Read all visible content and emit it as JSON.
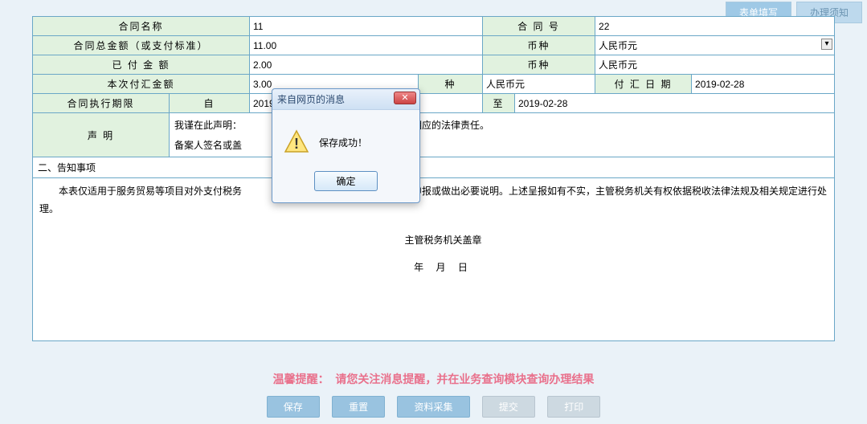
{
  "top_tabs": {
    "fill": "表单填写",
    "notes": "办理须知"
  },
  "form": {
    "row1": {
      "l1": "合同名称",
      "v1": "11",
      "l2": "合 同 号",
      "v2": "22"
    },
    "row2": {
      "l1": "合同总金额（或支付标准）",
      "v1": "11.00",
      "l2": "币种",
      "v2": "人民币元"
    },
    "row3": {
      "l1": "已 付 金 额",
      "v1": "2.00",
      "l2": "币种",
      "v2": "人民币元"
    },
    "row4": {
      "l1": "本次付汇金额",
      "v1": "3.00",
      "l2a": "",
      "l2b": "种",
      "v2": "人民币元",
      "l3": "付 汇 日 期",
      "v3": "2019-02-28"
    },
    "row5": {
      "l1": "合同执行期限",
      "from_label": "自",
      "from": "2019-02-",
      "to_label": "至",
      "to": "2019-02-28"
    },
    "declare": {
      "label": "声 明",
      "line1": "我谨在此声明：",
      "line1_tail": "；愿承担相应的法律责任。",
      "line2": "备案人签名或盖"
    }
  },
  "section2": {
    "title": "二、告知事项",
    "body_part1": "本表仅适用于服务贸易等项目对外支付税务",
    "body_part2": "务局进行纳税申报或做出必要说明。上述呈报如有不实，主管税务机关有权依据税收法律法规及相关规定进行处理。",
    "stamp": "主管税务机关盖章",
    "date": "年  月  日"
  },
  "reminder": {
    "label": "温馨提醒：",
    "text": "请您关注消息提醒，并在业务查询模块查询办理结果"
  },
  "footer": {
    "save": "保存",
    "reset": "重置",
    "collect": "资料采集",
    "submit": "提交",
    "print": "打印"
  },
  "dialog": {
    "title": "来自网页的消息",
    "message": "保存成功！",
    "ok": "确定",
    "close": "✕"
  }
}
